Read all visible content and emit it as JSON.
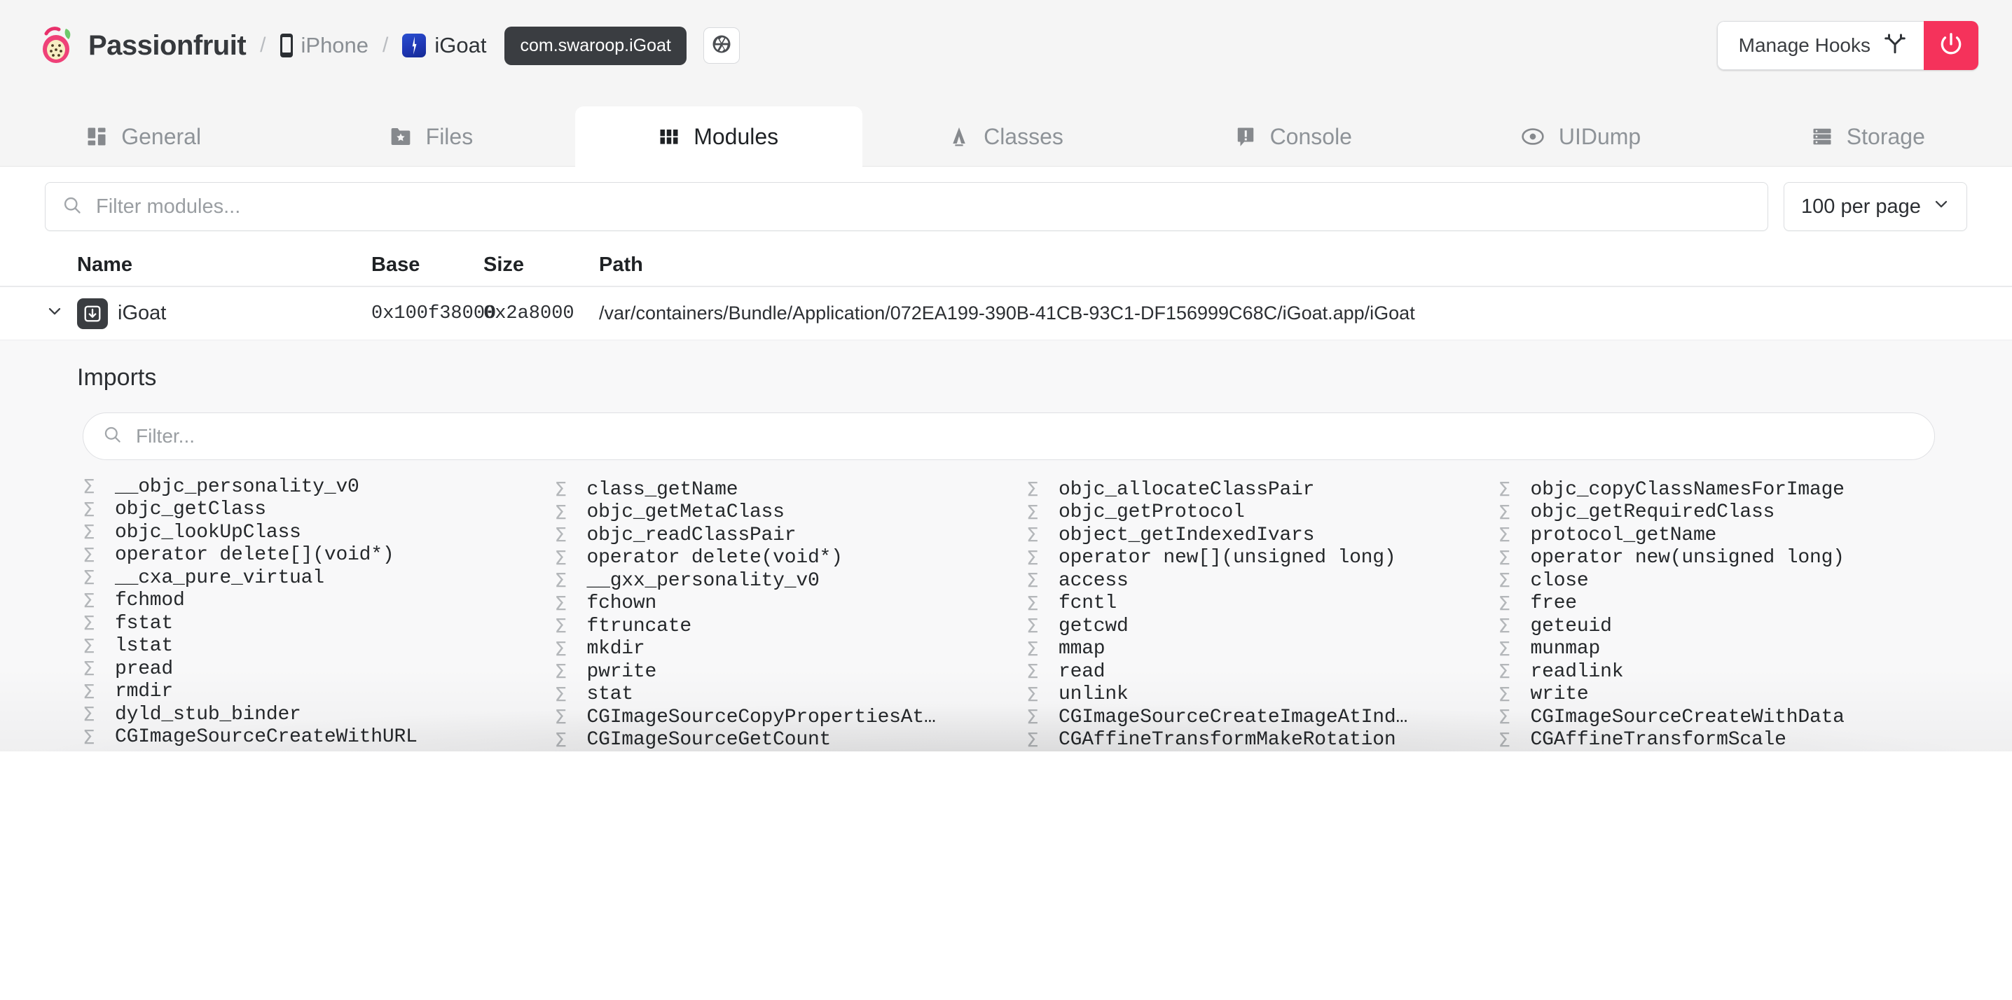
{
  "header": {
    "brand": "Passionfruit",
    "brand_logo_icon": "passionfruit-logo",
    "separator": "/",
    "device": "iPhone",
    "device_icon": "iphone-icon",
    "app": "iGoat",
    "app_icon": "igoat-app-icon",
    "bundle_id": "com.swaroop.iGoat",
    "snapshot_icon": "aperture-icon",
    "manage_hooks_label": "Manage Hooks",
    "manage_hooks_icon": "fork-branch-icon",
    "power_icon": "power-icon",
    "accent_color": "#f5325b"
  },
  "tabs": [
    {
      "label": "General",
      "icon": "dashboard-icon",
      "active": false
    },
    {
      "label": "Files",
      "icon": "folder-star-icon",
      "active": false
    },
    {
      "label": "Modules",
      "icon": "grid-icon",
      "active": true
    },
    {
      "label": "Classes",
      "icon": "classes-icon",
      "active": false
    },
    {
      "label": "Console",
      "icon": "console-icon",
      "active": false
    },
    {
      "label": "UIDump",
      "icon": "eye-icon",
      "active": false
    },
    {
      "label": "Storage",
      "icon": "storage-icon",
      "active": false
    }
  ],
  "toolbar": {
    "search_placeholder": "Filter modules...",
    "search_value": "",
    "search_icon": "search-icon",
    "per_page_label": "100 per page",
    "per_page_chevron_icon": "chevron-down-icon"
  },
  "table": {
    "columns": [
      "Name",
      "Base",
      "Size",
      "Path"
    ],
    "rows": [
      {
        "expanded": true,
        "chevron_icon": "chevron-down-icon",
        "module_icon": "module-download-icon",
        "name": "iGoat",
        "base": "0x100f38000",
        "size": "0x2a8000",
        "path": "/var/containers/Bundle/Application/072EA199-390B-41CB-93C1-DF156999C68C/iGoat.app/iGoat"
      }
    ]
  },
  "imports_panel": {
    "title": "Imports",
    "search_placeholder": "Filter...",
    "search_value": "",
    "search_icon": "search-icon",
    "symbol_icon": "sigma-icon",
    "columns": [
      [
        "__objc_personality_v0",
        "objc_getClass",
        "objc_lookUpClass",
        "operator delete[](void*)",
        "__cxa_pure_virtual",
        "fchmod",
        "fstat",
        "lstat",
        "pread",
        "rmdir",
        "dyld_stub_binder",
        "CGImageSourceCreateWithURL"
      ],
      [
        "class_getName",
        "objc_getMetaClass",
        "objc_readClassPair",
        "operator delete(void*)",
        "__gxx_personality_v0",
        "fchown",
        "ftruncate",
        "mkdir",
        "pwrite",
        "stat",
        "CGImageSourceCopyPropertiesAt…",
        "CGImageSourceGetCount"
      ],
      [
        "objc_allocateClassPair",
        "objc_getProtocol",
        "object_getIndexedIvars",
        "operator new[](unsigned long)",
        "access",
        "fcntl",
        "getcwd",
        "mmap",
        "read",
        "unlink",
        "CGImageSourceCreateImageAtInd…",
        "CGAffineTransformMakeRotation"
      ],
      [
        "objc_copyClassNamesForImage",
        "objc_getRequiredClass",
        "protocol_getName",
        "operator new(unsigned long)",
        "close",
        "free",
        "geteuid",
        "munmap",
        "readlink",
        "write",
        "CGImageSourceCreateWithData",
        "CGAffineTransformScale"
      ]
    ]
  }
}
